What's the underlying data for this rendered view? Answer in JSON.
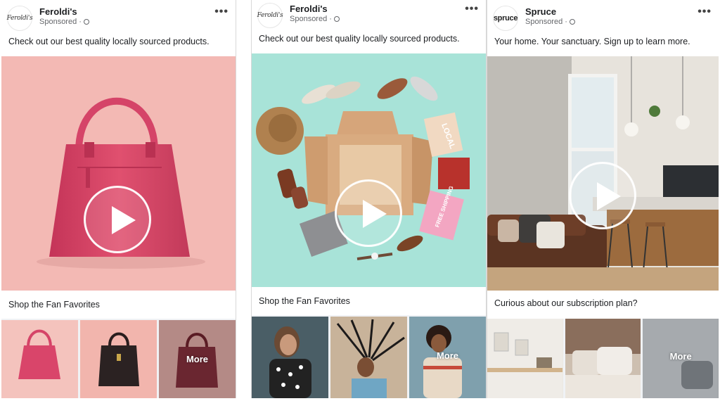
{
  "ads": [
    {
      "brand": "Feroldi's",
      "logo_text": "Feroldi's",
      "sponsored": "Sponsored ·",
      "menu_icon": "more-horizontal-icon",
      "caption": "Check out our best quality locally sourced products.",
      "cta": "Shop the Fan Favorites",
      "more_label": "More"
    },
    {
      "brand": "Feroldi's",
      "logo_text": "Feroldi's",
      "sponsored": "Sponsored ·",
      "menu_icon": "more-horizontal-icon",
      "caption": "Check out our best quality locally sourced products.",
      "cta": "Shop the Fan Favorites",
      "more_label": "More",
      "box_text_1": "LOCAL",
      "box_text_2": "FREE SHIPPING"
    },
    {
      "brand": "Spruce",
      "logo_text": "spruce",
      "sponsored": "Sponsored ·",
      "menu_icon": "more-horizontal-icon",
      "caption": "Your home. Your sanctuary. Sign up to learn more.",
      "cta": "Curious about our subscription plan?",
      "more_label": "More"
    }
  ],
  "colors": {
    "facebook_bg": "#f0f2f5",
    "card_bg": "#ffffff",
    "pink_bg": "#f3b9b4",
    "handbag": "#d9456a",
    "teal_bg": "#a8e3d8",
    "kitchen_wall": "#e9e6e0"
  }
}
